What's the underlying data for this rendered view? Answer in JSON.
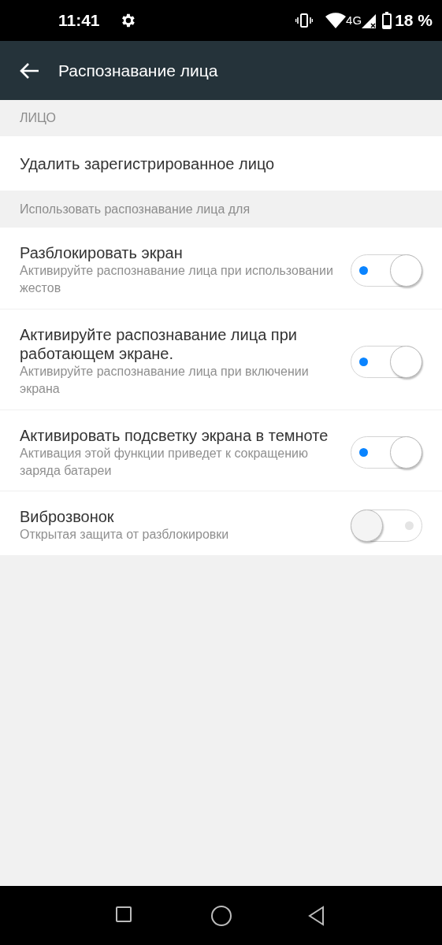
{
  "status_bar": {
    "time": "11:41",
    "network": "4G",
    "battery": "18 %"
  },
  "toolbar": {
    "title": "Распознавание лица"
  },
  "sections": [
    {
      "header": "ЛИЦО",
      "items": [
        {
          "kind": "action",
          "title": "Удалить зарегистрированное лицо"
        }
      ]
    },
    {
      "header": "Использовать распознавание лица для",
      "items": [
        {
          "kind": "switch",
          "title": "Разблокировать экран",
          "summary": "Активируйте распознавание лица при использовании жестов",
          "on": true
        },
        {
          "kind": "switch",
          "title": "Активируйте распознавание лица при работающем экране.",
          "summary": "Активируйте распознавание лица при включении экрана",
          "on": true
        },
        {
          "kind": "switch",
          "title": "Активировать подсветку экрана в темноте",
          "summary": "Активация этой функции приведет к сокращению заряда батареи",
          "on": true
        },
        {
          "kind": "switch",
          "title": "Виброзвонок",
          "summary": "Открытая защита от разблокировки",
          "on": false
        }
      ]
    }
  ]
}
